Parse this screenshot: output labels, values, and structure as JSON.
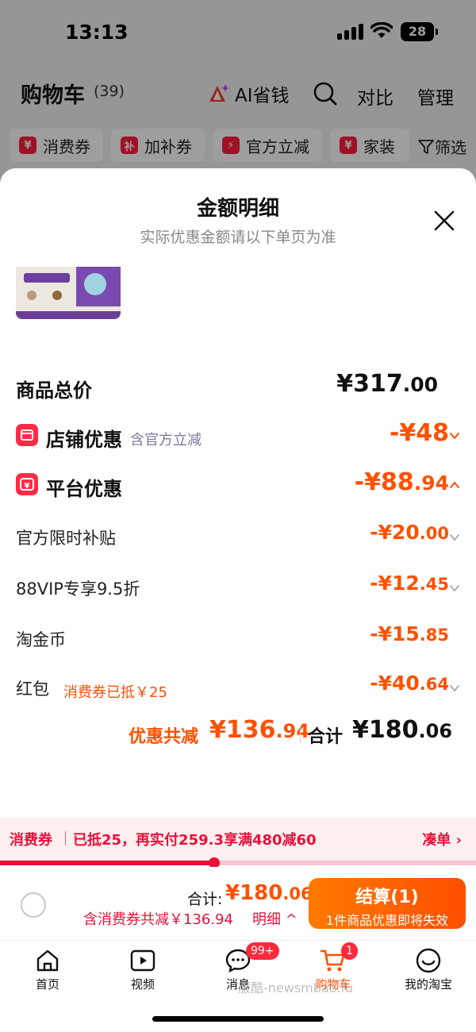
{
  "status_bar": {
    "time": "13:13",
    "battery": "28"
  },
  "cart_header": {
    "title": "购物车",
    "count": "(39)",
    "ai_label": "AI省钱",
    "compare": "对比",
    "manage": "管理"
  },
  "filters": [
    {
      "label": "消费券",
      "icon": "¥"
    },
    {
      "label": "加补券",
      "icon": "补"
    },
    {
      "label": "官方立减",
      "icon": "⚡"
    },
    {
      "label": "家装",
      "icon": "¥"
    }
  ],
  "filter_button": "筛选",
  "sheet": {
    "title": "金额明细",
    "subtitle": "实际优惠金额请以下单页为准"
  },
  "price": {
    "goods_total_label": "商品总价",
    "goods_total_int": "¥317",
    "goods_total_dec": ".00",
    "shop_discount_label": "店铺优惠",
    "shop_discount_note": "含官方立减",
    "shop_discount_int": "-¥48",
    "platform_discount_label": "平台优惠",
    "platform_discount_int": "-¥88",
    "platform_discount_dec": ".94",
    "items": [
      {
        "label": "官方限时补贴",
        "int": "-¥20",
        "dec": ".00",
        "note": ""
      },
      {
        "label": "88VIP专享9.5折",
        "int": "-¥12",
        "dec": ".45",
        "note": ""
      },
      {
        "label": "淘金币",
        "int": "-¥15",
        "dec": ".85",
        "note": ""
      },
      {
        "label": "红包",
        "int": "-¥40",
        "dec": ".64",
        "note": "消费券已抵￥25"
      }
    ],
    "savings_label": "优惠共减",
    "savings_int": "¥136",
    "savings_dec": ".94",
    "total_label": "合计",
    "total_int": "¥180",
    "total_dec": ".06"
  },
  "coupon": {
    "tag": "消费券",
    "text": "已抵25，再实付259.3享满480减60",
    "action": "凑单 ›",
    "progress": 0.45
  },
  "checkout": {
    "total_label": "合计:",
    "total_int": "¥180",
    "total_dec": ".06",
    "discount_text": "含消费券共减￥136.94",
    "detail": "明细 ^",
    "button_title": "结算(1)",
    "button_sub": "1件商品优惠即将失效"
  },
  "tabbar": {
    "tabs": [
      {
        "label": "首页",
        "icon": "home-icon"
      },
      {
        "label": "视频",
        "icon": "video-icon"
      },
      {
        "label": "消息",
        "icon": "message-icon",
        "badge": "99+"
      },
      {
        "label": "购物车",
        "icon": "cart-icon",
        "badge": "1"
      },
      {
        "label": "我的淘宝",
        "icon": "profile-icon"
      }
    ],
    "watermark": "服酷-newsmbao.fu"
  },
  "colors": {
    "accent": "#ff5000",
    "red": "#e8113a",
    "icon_red": "#ff2a45"
  }
}
